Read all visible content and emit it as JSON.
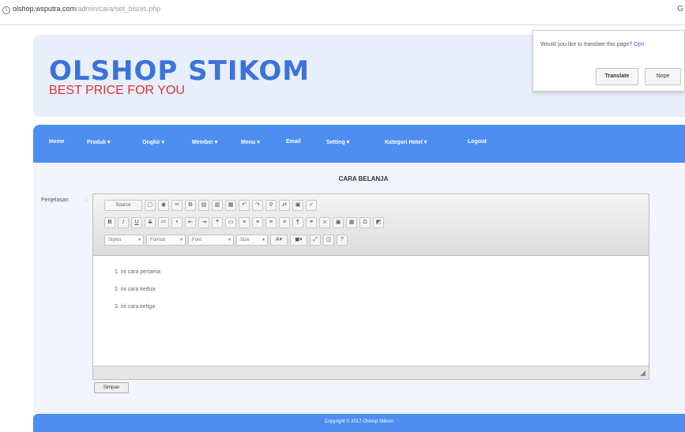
{
  "browser": {
    "url_host": "olshop.wsputra.com",
    "url_path": "/admin/cara/set_bisnis.php"
  },
  "translate_popup": {
    "question": "Would you like to translate this page?",
    "link": "Opti",
    "translate_label": "Translate",
    "nope_label": "Nope"
  },
  "header": {
    "title": "OLSHOP STIKOM",
    "subtitle": "BEST PRICE FOR YOU"
  },
  "nav": {
    "items": [
      "Home",
      "Produk ▾",
      "Ongkir ▾",
      "Member ▾",
      "Menu ▾",
      "Email",
      "Setting ▾",
      "Kategori Hotel ▾",
      "Logout"
    ]
  },
  "content": {
    "title": "CARA BELANJA",
    "field_label": "Penjelasan",
    "colon": ":"
  },
  "editor": {
    "source_label": "Source",
    "row1_icons": [
      "new-page-icon",
      "preview-icon",
      "cut-icon",
      "copy-icon",
      "paste-icon",
      "paste-text-icon",
      "paste-word-icon",
      "undo-icon",
      "redo-icon",
      "find-icon",
      "replace-icon",
      "select-all-icon",
      "spellcheck-icon"
    ],
    "row2_icons": [
      "B",
      "I",
      "U",
      "S",
      "1.",
      "•",
      "⇤",
      "⇥",
      "❝",
      "▭",
      "≡",
      "≡",
      "≡",
      "≡",
      "¶",
      "⚲",
      "⨯",
      "▣",
      "▦",
      "Ω",
      "◩"
    ],
    "styles_label": "Styles",
    "format_label": "Format",
    "font_label": "Font",
    "size_label": "Size",
    "lines": [
      "1. ini cara pertama",
      "2. ini cara kedua",
      "3. ini cara ketiga"
    ]
  },
  "save_label": "Simpan",
  "footer": {
    "text": "Copyright © 2017 Olshop Stikom"
  }
}
